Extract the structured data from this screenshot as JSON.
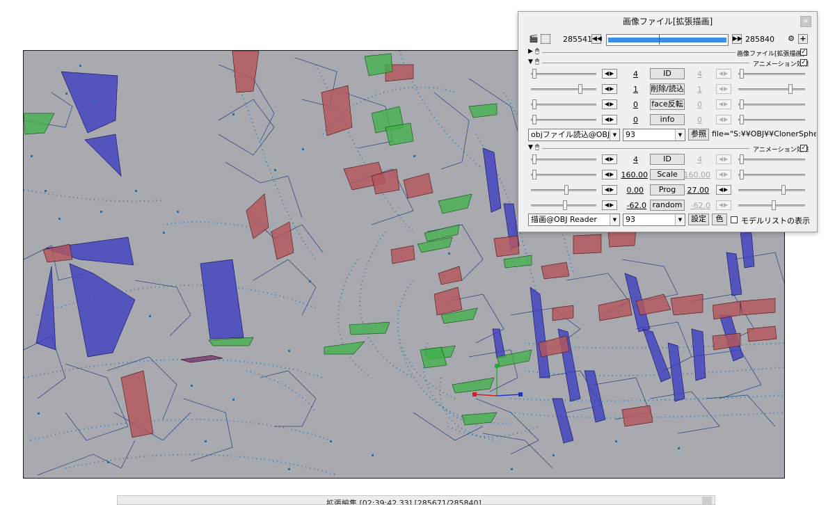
{
  "window": {
    "title": "画像ファイル[拡張描画]",
    "close_glyph": "×"
  },
  "timeline": {
    "start_frame": "285541",
    "end_frame": "285840",
    "left_icon": "clapper-icon",
    "right_icon": "gear-icon",
    "add_glyph": "+"
  },
  "sections": [
    {
      "label": "画像ファイル[拡張描画]",
      "checked": true
    },
    {
      "label": "アニメーション効果",
      "checked": true
    },
    {
      "label": "アニメーション効果",
      "checked": true
    }
  ],
  "group1": {
    "rows": [
      {
        "left": "4",
        "button": "ID",
        "right": "4"
      },
      {
        "left": "1",
        "button": "削除/読込",
        "right": "1"
      },
      {
        "left": "0",
        "button": "face反転",
        "right": "0"
      },
      {
        "left": "0",
        "button": "info",
        "right": "0"
      }
    ],
    "effect_select": "objファイル読込@OBJ Rea",
    "number_select": "93",
    "ref_button": "参照",
    "file_text": "file=\"S:¥¥OBJ¥¥ClonerSphere"
  },
  "group2": {
    "rows": [
      {
        "left": "4",
        "button": "ID",
        "right": "4"
      },
      {
        "left": "160.00",
        "button": "Scale",
        "right": "160.00"
      },
      {
        "left": "0.00",
        "button": "Prog",
        "right": "27.00"
      },
      {
        "left": "-62.0",
        "button": "random",
        "right": "-62.0"
      }
    ],
    "effect_select": "描画@OBJ Reader",
    "number_select": "93",
    "settings_button": "設定",
    "color_button": "色",
    "model_list_label": "モデルリストの表示"
  },
  "bottom_window": {
    "title": "拡張編集 [02:39:42.33] [285671/285840]"
  },
  "viewport_colors": {
    "background": "#a8aab0",
    "blue": "#3c3cc0",
    "red": "#b4555a",
    "green": "#3fb24a",
    "dots": "#1e6fb0"
  }
}
